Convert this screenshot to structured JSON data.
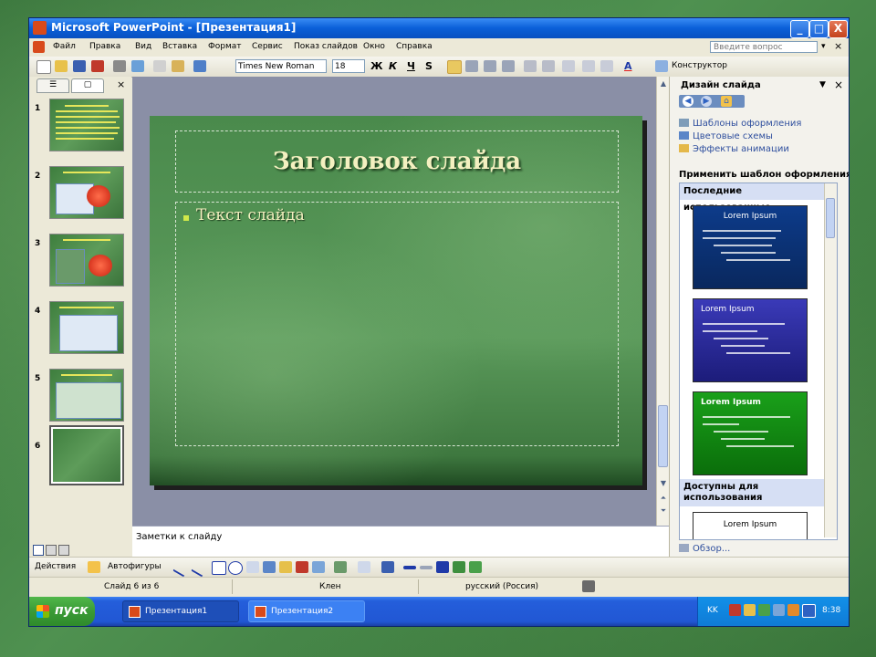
{
  "window": {
    "title": "Microsoft PowerPoint - [Презентация1]",
    "min": "_",
    "max": "□",
    "close": "X"
  },
  "menu": {
    "items": [
      "Файл",
      "Правка",
      "Вид",
      "Вставка",
      "Формат",
      "Сервис",
      "Показ слайдов",
      "Окно",
      "Справка"
    ],
    "ask_placeholder": "Введите вопрос",
    "close": "×",
    "dropdown": "▾"
  },
  "toolbar": {
    "font": "Times New Roman",
    "size": "18",
    "bold": "Ж",
    "italic": "К",
    "underline": "Ч",
    "shadow": "S",
    "font_color": "A",
    "design_label": "Конструктор"
  },
  "left_panel": {
    "tab_outline": "☰",
    "tab_slides": "▢",
    "tab_close": "×",
    "thumbs": [
      "1",
      "2",
      "3",
      "4",
      "5",
      "6"
    ]
  },
  "slide": {
    "title": "Заголовок слайда",
    "body": "Текст слайда"
  },
  "notes": {
    "placeholder": "Заметки к слайду"
  },
  "drawing": {
    "actions": "Действия",
    "autoshapes": "Автофигуры"
  },
  "status": {
    "slide": "Слайд 6 из 6",
    "design": "Клен",
    "language": "русский (Россия)"
  },
  "taskbar": {
    "start": "пуск",
    "tasks": [
      "Презентация1",
      "Презентация2"
    ],
    "lang": "KK",
    "time": "8:38"
  },
  "task_pane": {
    "title": "Дизайн слайда",
    "links": [
      "Шаблоны оформления",
      "Цветовые схемы",
      "Эффекты анимации"
    ],
    "apply_label": "Применить шаблон оформления:",
    "section_recent": "Последние использованные",
    "section_available": "Доступны для использования",
    "templates": [
      "Lorem Ipsum",
      "Lorem Ipsum",
      "Lorem Ipsum",
      "Lorem Ipsum"
    ],
    "browse": "Обзор...",
    "close": "×",
    "dropdown": "▼"
  },
  "colors": {
    "slide_green": "#4a8a4c",
    "title_text": "#f4f0c0",
    "xp_blue": "#245edb"
  }
}
